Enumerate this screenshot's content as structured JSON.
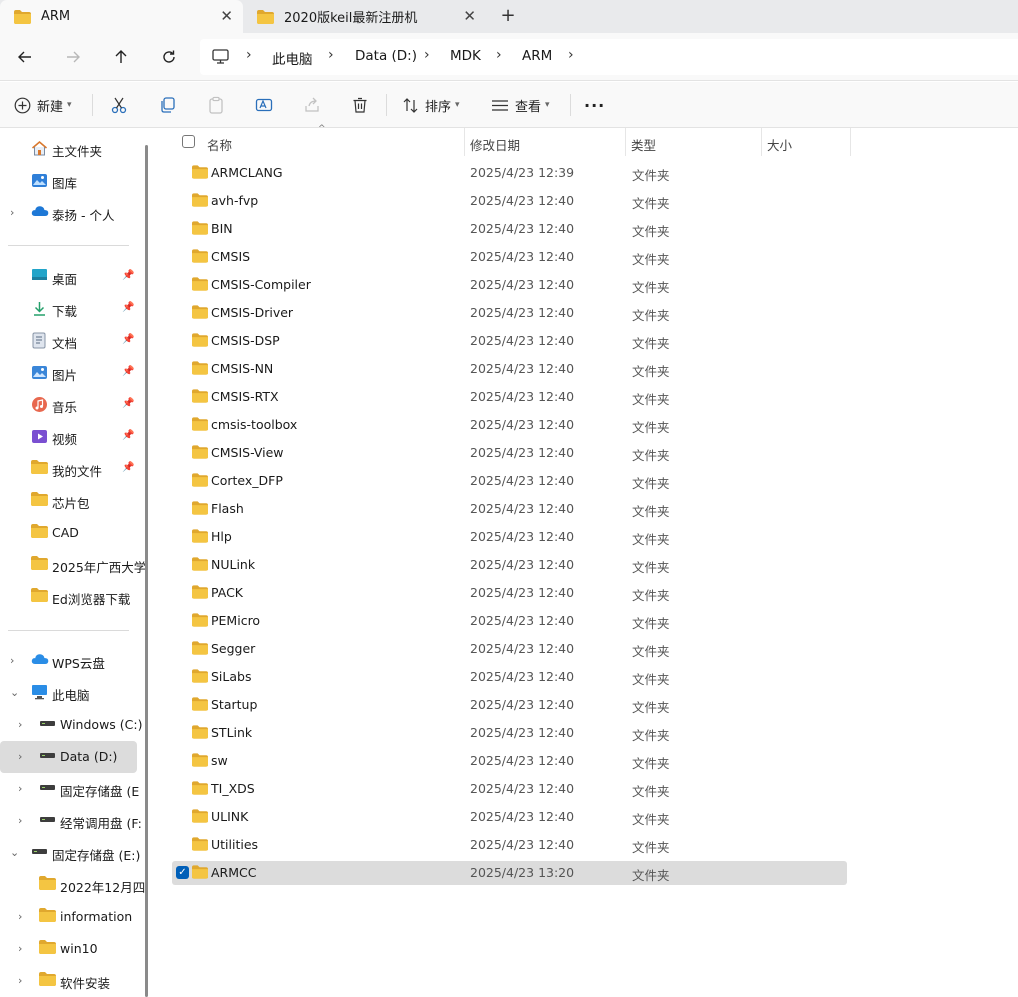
{
  "tabs": [
    {
      "title": "ARM",
      "active": true
    },
    {
      "title": "2020版keil最新注册机",
      "active": false
    }
  ],
  "breadcrumb": [
    "此电脑",
    "Data (D:)",
    "MDK",
    "ARM"
  ],
  "toolbar": {
    "new_label": "新建",
    "sort_label": "排序",
    "view_label": "查看",
    "more_label": "···"
  },
  "sidebar": {
    "quick": [
      {
        "label": "主文件夹",
        "icon": "home-icon"
      },
      {
        "label": "图库",
        "icon": "gallery-icon"
      },
      {
        "label": "泰扬 - 个人",
        "icon": "onedrive-icon"
      }
    ],
    "pinned": [
      {
        "label": "桌面",
        "icon": "desktop-icon"
      },
      {
        "label": "下载",
        "icon": "download-icon"
      },
      {
        "label": "文档",
        "icon": "documents-icon"
      },
      {
        "label": "图片",
        "icon": "pictures-icon"
      },
      {
        "label": "音乐",
        "icon": "music-icon"
      },
      {
        "label": "视频",
        "icon": "videos-icon"
      },
      {
        "label": "我的文件",
        "icon": "folder-icon"
      },
      {
        "label": "芯片包",
        "icon": "folder-icon"
      },
      {
        "label": "CAD",
        "icon": "folder-icon"
      },
      {
        "label": "2025年广西大学",
        "icon": "folder-icon"
      },
      {
        "label": "Ed浏览器下载",
        "icon": "folder-icon"
      }
    ],
    "tree": [
      {
        "label": "WPS云盘",
        "icon": "cloud-icon"
      },
      {
        "label": "此电脑",
        "icon": "computer-icon"
      },
      {
        "label": "Windows (C:)",
        "icon": "drive-icon"
      },
      {
        "label": "Data (D:)",
        "icon": "drive-icon"
      },
      {
        "label": "固定存储盘 (E",
        "icon": "drive-icon"
      },
      {
        "label": "经常调用盘 (F:",
        "icon": "drive-icon"
      },
      {
        "label": "固定存储盘 (E:)",
        "icon": "drive-icon"
      },
      {
        "label": "2022年12月四",
        "icon": "folder-icon"
      },
      {
        "label": "information",
        "icon": "folder-icon"
      },
      {
        "label": "win10",
        "icon": "folder-icon"
      },
      {
        "label": "软件安装",
        "icon": "folder-icon"
      }
    ]
  },
  "columns": {
    "name": "名称",
    "date": "修改日期",
    "type": "类型",
    "size": "大小"
  },
  "files": [
    {
      "name": "ARMCLANG",
      "date": "2025/4/23 12:39",
      "type": "文件夹"
    },
    {
      "name": "avh-fvp",
      "date": "2025/4/23 12:40",
      "type": "文件夹"
    },
    {
      "name": "BIN",
      "date": "2025/4/23 12:40",
      "type": "文件夹"
    },
    {
      "name": "CMSIS",
      "date": "2025/4/23 12:40",
      "type": "文件夹"
    },
    {
      "name": "CMSIS-Compiler",
      "date": "2025/4/23 12:40",
      "type": "文件夹"
    },
    {
      "name": "CMSIS-Driver",
      "date": "2025/4/23 12:40",
      "type": "文件夹"
    },
    {
      "name": "CMSIS-DSP",
      "date": "2025/4/23 12:40",
      "type": "文件夹"
    },
    {
      "name": "CMSIS-NN",
      "date": "2025/4/23 12:40",
      "type": "文件夹"
    },
    {
      "name": "CMSIS-RTX",
      "date": "2025/4/23 12:40",
      "type": "文件夹"
    },
    {
      "name": "cmsis-toolbox",
      "date": "2025/4/23 12:40",
      "type": "文件夹"
    },
    {
      "name": "CMSIS-View",
      "date": "2025/4/23 12:40",
      "type": "文件夹"
    },
    {
      "name": "Cortex_DFP",
      "date": "2025/4/23 12:40",
      "type": "文件夹"
    },
    {
      "name": "Flash",
      "date": "2025/4/23 12:40",
      "type": "文件夹"
    },
    {
      "name": "Hlp",
      "date": "2025/4/23 12:40",
      "type": "文件夹"
    },
    {
      "name": "NULink",
      "date": "2025/4/23 12:40",
      "type": "文件夹"
    },
    {
      "name": "PACK",
      "date": "2025/4/23 12:40",
      "type": "文件夹"
    },
    {
      "name": "PEMicro",
      "date": "2025/4/23 12:40",
      "type": "文件夹"
    },
    {
      "name": "Segger",
      "date": "2025/4/23 12:40",
      "type": "文件夹"
    },
    {
      "name": "SiLabs",
      "date": "2025/4/23 12:40",
      "type": "文件夹"
    },
    {
      "name": "Startup",
      "date": "2025/4/23 12:40",
      "type": "文件夹"
    },
    {
      "name": "STLink",
      "date": "2025/4/23 12:40",
      "type": "文件夹"
    },
    {
      "name": "sw",
      "date": "2025/4/23 12:40",
      "type": "文件夹"
    },
    {
      "name": "TI_XDS",
      "date": "2025/4/23 12:40",
      "type": "文件夹"
    },
    {
      "name": "ULINK",
      "date": "2025/4/23 12:40",
      "type": "文件夹"
    },
    {
      "name": "Utilities",
      "date": "2025/4/23 12:40",
      "type": "文件夹"
    },
    {
      "name": "ARMCC",
      "date": "2025/4/23 13:20",
      "type": "文件夹"
    }
  ],
  "selected_file": "ARMCC",
  "colors": {
    "folder": "#f4c542",
    "folder_dark": "#e0a82e",
    "selection": "#dcdcdc",
    "accent": "#005fb8"
  }
}
